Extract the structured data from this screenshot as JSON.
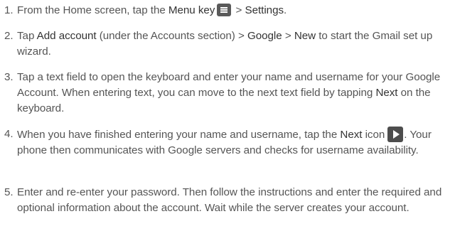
{
  "steps": [
    {
      "number": "1.",
      "t1": "From the Home screen, tap the ",
      "b1": "Menu key",
      "icon": "menu-key-icon",
      "t2": " > ",
      "b2": "Settings",
      "t3": "."
    },
    {
      "number": "2.",
      "t1": "Tap ",
      "b1": "Add account",
      "t2": " (under the Accounts section) > ",
      "b2": "Google",
      "t3": " > ",
      "b3": "New",
      "t4": " to start the Gmail set up wizard."
    },
    {
      "number": "3.",
      "t1": "Tap a text field to open the keyboard and enter your name and username for your Google Account. When entering text, you can move to the next text field by tapping ",
      "b1": "Next",
      "t2": " on the keyboard."
    },
    {
      "number": "4.",
      "t1": "When you have finished entering your name and username, tap the ",
      "b1": "Next",
      "t2": " icon",
      "icon": "next-arrow-icon",
      "t3": ". Your phone then communicates with Google servers and checks for username availability."
    },
    {
      "number": "5.",
      "t1": "Enter and re-enter your password. Then follow the instructions and enter the required and optional information about the account. Wait while the server creates your account."
    }
  ]
}
